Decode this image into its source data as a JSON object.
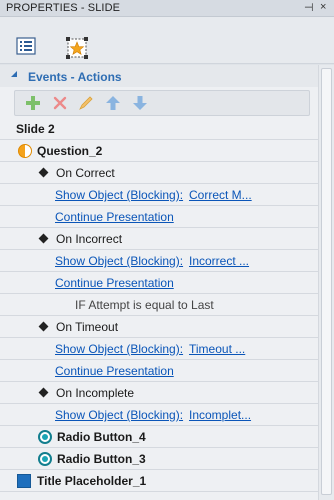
{
  "window": {
    "title": "PROPERTIES - SLIDE",
    "pin_glyph": "⊣",
    "close_glyph": "×"
  },
  "icon_bar": {
    "items": [
      {
        "name": "slide-list-icon"
      },
      {
        "name": "slide-effects-icon"
      }
    ]
  },
  "section": {
    "title": "Events - Actions"
  },
  "toolbar": {
    "buttons": [
      "add-icon",
      "delete-icon",
      "edit-icon",
      "move-up-icon",
      "move-down-icon"
    ]
  },
  "tree": {
    "slide": "Slide 2",
    "question": "Question_2",
    "on_correct": "On Correct",
    "correct_show_prefix": "Show Object (Blocking):",
    "correct_show_target": "Correct M...",
    "correct_continue": "Continue Presentation",
    "on_incorrect": "On Incorrect",
    "incorrect_show_prefix": "Show Object (Blocking):",
    "incorrect_show_target": "Incorrect ...",
    "incorrect_continue": "Continue Presentation",
    "condition": "IF Attempt is equal to Last",
    "on_timeout": "On Timeout",
    "timeout_show_prefix": "Show Object (Blocking):",
    "timeout_show_target": "Timeout ...",
    "timeout_continue": "Continue Presentation",
    "on_incomplete": "On Incomplete",
    "incomplete_show_prefix": "Show Object (Blocking):",
    "incomplete_show_target": "Incomplet...",
    "radio4": "Radio Button_4",
    "radio3": "Radio Button_3",
    "title_placeholder": "Title Placeholder_1"
  },
  "colors": {
    "link": "#0a55b8",
    "section_title": "#2e6db3",
    "radio": "#127e8e",
    "question_icon": "#f4a21b",
    "placeholder_icon": "#1e6fbd"
  }
}
